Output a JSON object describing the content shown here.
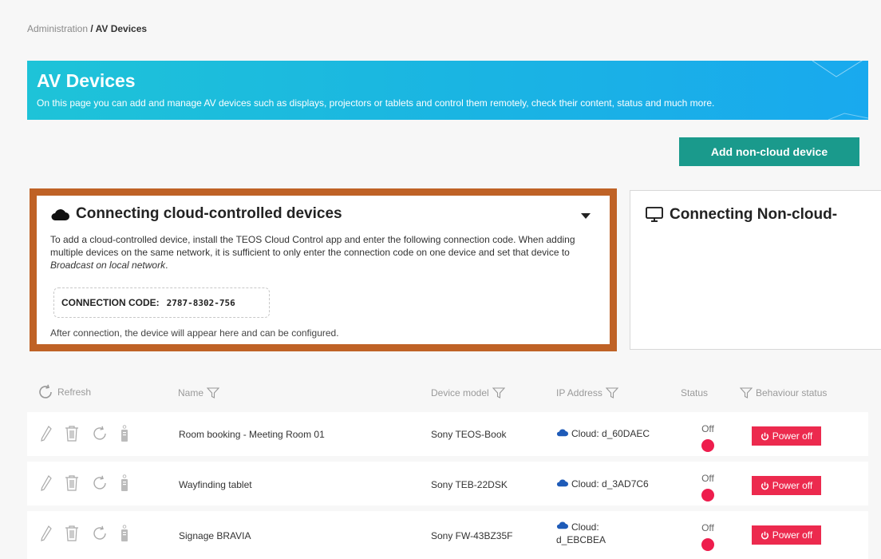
{
  "breadcrumb": {
    "parent": "Administration",
    "separator": " / ",
    "current": "AV Devices"
  },
  "banner": {
    "title": "AV Devices",
    "subtitle": "On this page you can add and manage AV devices such as displays, projectors or tablets and control them remotely, check their content, status and much more."
  },
  "actions": {
    "add_noncloud": "Add non-cloud device"
  },
  "cloud_panel": {
    "title": "Connecting cloud-controlled devices",
    "description_main": "To add a cloud-controlled device, install the TEOS Cloud Control app and enter the following connection code. When adding multiple devices on the same network, it is sufficient to only enter the connection code on one device and set that device to ",
    "description_em": "Broadcast on local network",
    "description_end": ".",
    "code_label": "CONNECTION CODE:",
    "code_value": "2787-8302-756",
    "after_text": "After connection, the device will appear here and can be configured."
  },
  "noncloud_panel": {
    "title": "Connecting Non-cloud-"
  },
  "table": {
    "columns": {
      "refresh": "Refresh",
      "name": "Name",
      "model": "Device model",
      "ip": "IP Address",
      "status": "Status",
      "behaviour": "Behaviour status"
    },
    "rows": [
      {
        "name": "Room booking - Meeting Room 01",
        "model": "Sony TEOS-Book",
        "ip_line1": "Cloud: d_60DAEC",
        "ip_line2": "",
        "status": "Off",
        "behaviour": "Power off"
      },
      {
        "name": "Wayfinding tablet",
        "model": "Sony TEB-22DSK",
        "ip_line1": "Cloud: d_3AD7C6",
        "ip_line2": "",
        "status": "Off",
        "behaviour": "Power off"
      },
      {
        "name": "Signage BRAVIA",
        "model": "Sony FW-43BZ35F",
        "ip_line1": "Cloud:",
        "ip_line2": "d_EBCBEA",
        "status": "Off",
        "behaviour": "Power off"
      }
    ]
  },
  "colors": {
    "accent_teal": "#1a9a8c",
    "banner_cyan": "#1ab4e3",
    "highlight_border": "#bf6226",
    "status_red": "#ee1d4d",
    "cloud_icon": "#1e5bb8"
  }
}
